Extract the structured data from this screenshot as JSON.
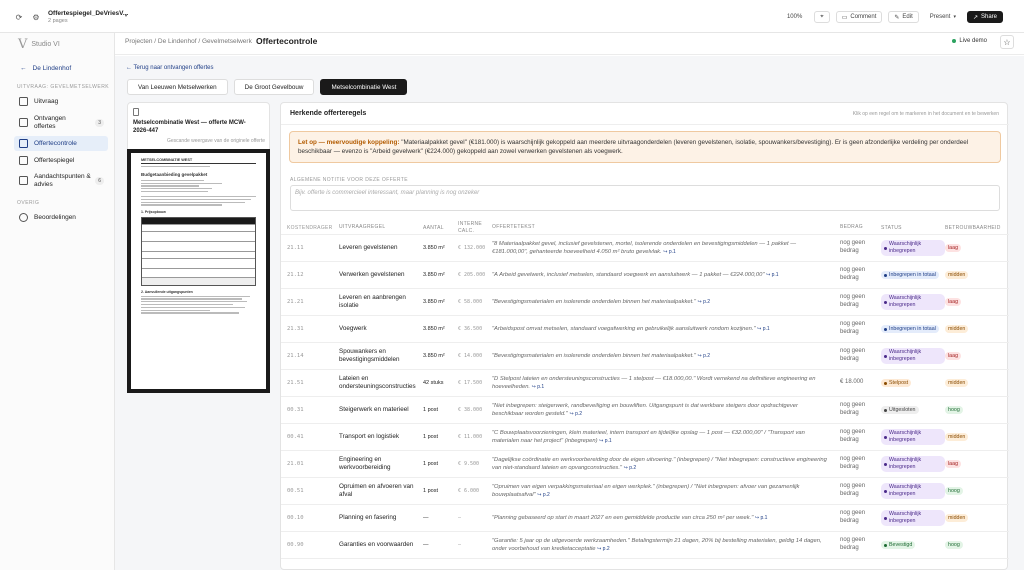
{
  "topbar": {
    "doc_title": "Offertespiegel_DeVriesV...",
    "doc_sub": "2 pages",
    "zoom": "100%",
    "comment": "Comment",
    "edit": "Edit",
    "present": "Present",
    "share": "Share"
  },
  "sidebar": {
    "brand": "Studio VI",
    "back": "De Lindenhof",
    "section1": "UITVRAAG: GEVELMETSELWERK",
    "section2": "OVERIG",
    "items": [
      {
        "label": "Uitvraag",
        "badge": ""
      },
      {
        "label": "Ontvangen offertes",
        "badge": "3"
      },
      {
        "label": "Offertecontrole",
        "badge": ""
      },
      {
        "label": "Offertespiegel",
        "badge": ""
      },
      {
        "label": "Aandachtspunten & advies",
        "badge": "6"
      }
    ],
    "overig": [
      {
        "label": "Beoordelingen"
      }
    ]
  },
  "header": {
    "breadcrumb": "Projecten / De Lindenhof / Gevelmetselwerk",
    "title": "Offertecontrole",
    "live": "Live demo"
  },
  "main": {
    "back_link": "← Terug naar ontvangen offertes",
    "tabs": [
      {
        "label": "Van Leeuwen Metselwerken"
      },
      {
        "label": "De Groot Gevelbouw"
      },
      {
        "label": "Metselcombinatie West"
      }
    ],
    "doc_card": {
      "title": "Metselcombinatie West — offerte MCW-2026-447",
      "caption": "Gescande weergave van de originele offerte",
      "page": {
        "brand": "METSELCOMBINATIE WEST",
        "heading": "Budgetaanbieding gevelpakket",
        "sec1": "1. Prijsopbouw",
        "sec2": "2. Aanvullende uitgangspunten"
      }
    },
    "panel": {
      "title": "Herkende offerteregels",
      "hint": "Klik op een regel om te markeren in het document en te bewerken",
      "alert_strong": "Let op — meervoudige koppeling:",
      "alert_text": " \"Materiaalpakket gevel\" (€181.000) is waarschijnlijk gekoppeld aan meerdere uitvraagonderdelen (leveren gevelstenen, isolatie, spouwankers/bevestiging). Er is geen afzonderlijke verdeling per onderdeel beschikbaar — evenzo is \"Arbeid gevelwerk\" (€224.000) gekoppeld aan zowel verwerken gevelstenen als voegwerk.",
      "note_label": "ALGEMENE NOTITIE VOOR DEZE OFFERTE",
      "note_placeholder": "Bijv. offerte is commercieel interessant, maar planning is nog onzeker",
      "columns": [
        "KOSTENDRAGER",
        "UITVRAAGREGEL",
        "AANTAL",
        "INTERNE CALC.",
        "OFFERTETEKST",
        "BEDRAG",
        "STATUS",
        "BETROUWBAARHEID"
      ],
      "rows": [
        {
          "code": "21.11",
          "rule": "Leveren gevelstenen",
          "qty": "3.850 m²",
          "calc": "€ 132.000",
          "text": "\"8 Materiaalpakket gevel, inclusief gevelstenen, mortel, isolerende onderdelen en bevestigingsmiddelen — 1 pakket — €181.000,00\", gehanteerde hoeveelheid 4.050 m² bruto gevelvlak.",
          "ref": "↪ p.1",
          "amount": "nog geen bedrag",
          "status": "Waarschijnlijk inbegrepen",
          "st": "s-ww",
          "rel": "laag",
          "rl": "r-laag"
        },
        {
          "code": "21.12",
          "rule": "Verwerken gevelstenen",
          "qty": "3.850 m²",
          "calc": "€ 205.000",
          "text": "\"A Arbeid gevelwerk, inclusief metselen, standaard voegwerk en aansluitwerk — 1 pakket — €224.000,00\"",
          "ref": "↪ p.1",
          "amount": "nog geen bedrag",
          "status": "Inbegrepen in totaal",
          "st": "s-it",
          "rel": "midden",
          "rl": "r-mid"
        },
        {
          "code": "21.21",
          "rule": "Leveren en aanbrengen isolatie",
          "qty": "3.850 m²",
          "calc": "€ 58.000",
          "text": "\"Bevestigingsmaterialen en isolerende onderdelen binnen het materiaalpakket.\"",
          "ref": "↪ p.2",
          "amount": "nog geen bedrag",
          "status": "Waarschijnlijk inbegrepen",
          "st": "s-ww",
          "rel": "laag",
          "rl": "r-laag"
        },
        {
          "code": "21.31",
          "rule": "Voegwerk",
          "qty": "3.850 m²",
          "calc": "€ 36.500",
          "text": "\"Arbeidspost omvat metselen, standaard voegafwerking en gebruikelijk aansluitwerk rondom kozijnen.\"",
          "ref": "↪ p.1",
          "amount": "nog geen bedrag",
          "status": "Inbegrepen in totaal",
          "st": "s-it",
          "rel": "midden",
          "rl": "r-mid"
        },
        {
          "code": "21.14",
          "rule": "Spouwankers en bevestigingsmiddelen",
          "qty": "3.850 m²",
          "calc": "€ 14.000",
          "text": "\"Bevestigingsmaterialen en isolerende onderdelen binnen het materiaalpakket.\"",
          "ref": "↪ p.2",
          "amount": "nog geen bedrag",
          "status": "Waarschijnlijk inbegrepen",
          "st": "s-ww",
          "rel": "laag",
          "rl": "r-laag"
        },
        {
          "code": "21.51",
          "rule": "Lateien en ondersteuningsconstructies",
          "qty": "42 stuks",
          "calc": "€ 17.500",
          "text": "\"D Stelpost lateien en ondersteuningsconstructies — 1 stelpost — €18.000,00.\" Wordt verrekend na definitieve engineering en hoeveelheden.",
          "ref": "↪ p.1",
          "amount": "€ 18.000",
          "status": "Stelpost",
          "st": "s-st",
          "rel": "midden",
          "rl": "r-mid"
        },
        {
          "code": "00.31",
          "rule": "Steigerwerk en materieel",
          "qty": "1 post",
          "calc": "€ 38.000",
          "text": "\"Niet inbegrepen: steigerwerk, randbeveiliging en bouwliften. Uitgangspunt is dat werkbare steigers door opdrachtgever beschikbaar worden gesteld.\"",
          "ref": "↪ p.2",
          "amount": "nog geen bedrag",
          "status": "Uitgesloten",
          "st": "s-ui",
          "rel": "hoog",
          "rl": "r-hoog"
        },
        {
          "code": "00.41",
          "rule": "Transport en logistiek",
          "qty": "1 post",
          "calc": "€ 11.000",
          "text": "\"C Bouwplaatsvoorzieningen, klein materieel, intern transport en tijdelijke opslag — 1 post — €32.000,00\" / \"Transport van materialen naar het project\" (inbegrepen)",
          "ref": "↪ p.1",
          "amount": "nog geen bedrag",
          "status": "Waarschijnlijk inbegrepen",
          "st": "s-ww",
          "rel": "midden",
          "rl": "r-mid"
        },
        {
          "code": "21.01",
          "rule": "Engineering en werkvoorbereiding",
          "qty": "1 post",
          "calc": "€ 9.500",
          "text": "\"Dagelijkse coördinatie en werkvoorbereiding door de eigen uitvoering.\" (inbegrepen) / \"Niet inbegrepen: constructieve engineering van niet-standaard lateien en opvangconstructies.\"",
          "ref": "↪ p.2",
          "amount": "nog geen bedrag",
          "status": "Waarschijnlijk inbegrepen",
          "st": "s-ww",
          "rel": "laag",
          "rl": "r-laag"
        },
        {
          "code": "00.51",
          "rule": "Opruimen en afvoeren van afval",
          "qty": "1 post",
          "calc": "€ 6.000",
          "text": "\"Opruimen van eigen verpakkingsmateriaal en eigen werkplek.\" (inbegrepen) / \"Niet inbegrepen: afvoer van gezamenlijk bouwplaatsafval\"",
          "ref": "↪ p.2",
          "amount": "nog geen bedrag",
          "status": "Waarschijnlijk inbegrepen",
          "st": "s-ww",
          "rel": "hoog",
          "rl": "r-hoog"
        },
        {
          "code": "00.10",
          "rule": "Planning en fasering",
          "qty": "—",
          "calc": "—",
          "text": "\"Planning gebaseerd op start in maart 2027 en een gemiddelde productie van circa 250 m² per week.\"",
          "ref": "↪ p.1",
          "amount": "nog geen bedrag",
          "status": "Waarschijnlijk inbegrepen",
          "st": "s-ww",
          "rel": "midden",
          "rl": "r-mid"
        },
        {
          "code": "00.90",
          "rule": "Garanties en voorwaarden",
          "qty": "—",
          "calc": "—",
          "text": "\"Garantie: 5 jaar op de uitgevoerde werkzaamheden.\" Betalingstermijn 21 dagen, 20% bij bestelling materialen, geldig 14 dagen, onder voorbehoud van kredietacceptatie",
          "ref": "↪ p.2",
          "amount": "nog geen bedrag",
          "status": "Bevestigd",
          "st": "s-be",
          "rel": "hoog",
          "rl": "r-hoog"
        }
      ]
    }
  }
}
